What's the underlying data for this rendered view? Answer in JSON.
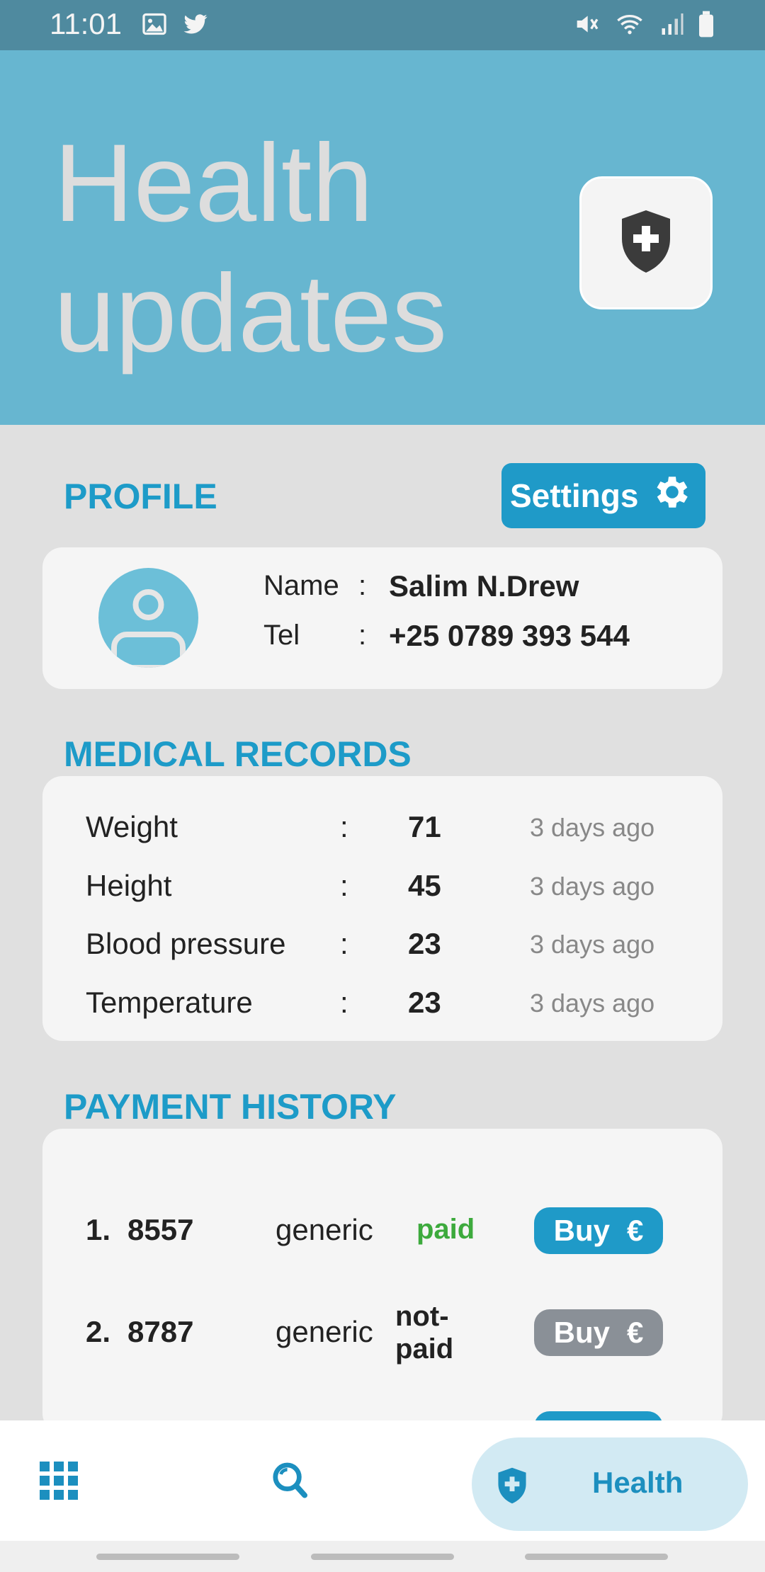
{
  "status_bar": {
    "time": "11:01",
    "left_icons": [
      "image-icon",
      "twitter-icon"
    ],
    "right_icons": [
      "mute-icon",
      "wifi-icon",
      "signal-icon",
      "battery-icon"
    ]
  },
  "header": {
    "title": "Health updates",
    "badge_icon": "shield-plus-icon"
  },
  "profile": {
    "section_title": "PROFILE",
    "settings_label": "Settings",
    "settings_icon": "gear-icon",
    "name_label": "Name",
    "tel_label": "Tel",
    "separator": ":",
    "name_value": "Salim N.Drew",
    "tel_value": "+25 0789 393 544"
  },
  "medical_records": {
    "section_title": "MEDICAL RECORDS",
    "separator": ":",
    "rows": [
      {
        "label": "Weight",
        "value": "71",
        "time": "3 days ago"
      },
      {
        "label": "Height",
        "value": "45",
        "time": "3 days ago"
      },
      {
        "label": "Blood pressure",
        "value": "23",
        "time": "3 days ago"
      },
      {
        "label": "Temperature",
        "value": "23",
        "time": "3 days ago"
      }
    ]
  },
  "payment_history": {
    "section_title": "PAYMENT HISTORY",
    "rows": [
      {
        "index": "1.",
        "code": "8557",
        "type": "generic",
        "status": "paid",
        "button": "Buy",
        "currency": "€"
      },
      {
        "index": "2.",
        "code": "8787",
        "type": "generic",
        "status": "not-paid",
        "button": "Buy",
        "currency": "€"
      }
    ]
  },
  "bottom_nav": {
    "items": [
      "grid-icon",
      "search-icon"
    ],
    "active_label": "Health",
    "active_icon": "shield-plus-icon"
  },
  "colors": {
    "accent": "#1f9ac8",
    "header_bg": "#67b6d0",
    "paid": "#3daa3d",
    "disabled_button": "#8a9097"
  }
}
